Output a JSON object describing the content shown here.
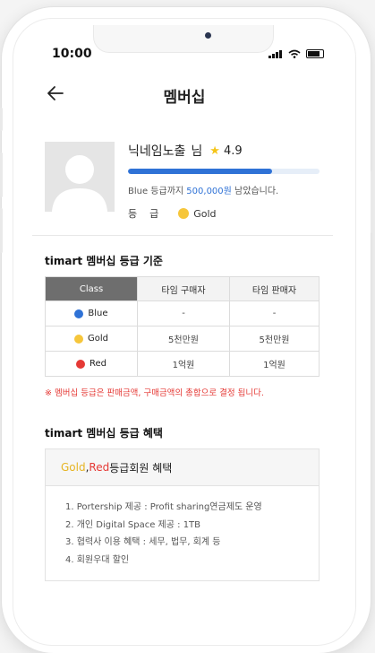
{
  "status_bar": {
    "time": "10:00"
  },
  "header": {
    "title": "멤버십"
  },
  "profile": {
    "nickname": "닉네임노출",
    "suffix": "님",
    "rating": "4.9",
    "progress": 0.75,
    "upgrade_prefix": "Blue 등급까지 ",
    "upgrade_amount": "500,000원",
    "upgrade_suffix": " 남았습니다.",
    "grade_label": "등급",
    "grade_value": "Gold"
  },
  "criteria": {
    "title": "timart 멤버십 등급 기준",
    "columns": [
      "Class",
      "타임 구매자",
      "타임 판매자"
    ],
    "rows": [
      {
        "class": "Blue",
        "color": "#2f72d6",
        "buyer": "-",
        "seller": "-"
      },
      {
        "class": "Gold",
        "color": "#f6c63b",
        "buyer": "5천만원",
        "seller": "5천만원"
      },
      {
        "class": "Red",
        "color": "#e53935",
        "buyer": "1억원",
        "seller": "1억원"
      }
    ],
    "notice": "※ 멤버십 등급은 판매금액, 구매금액의 총합으로 결정 됩니다."
  },
  "benefits": {
    "title": "timart 멤버십 등급 혜택",
    "head_gold": "Gold",
    "head_sep": ", ",
    "head_red": "Red",
    "head_rest": " 등급회원 혜택",
    "items": [
      "1. Portership 제공 : Profit sharing연금제도 운영",
      "2. 개인 Digital Space 제공 : 1TB",
      "3. 협력사 이용 혜택 : 세무, 법무, 회계 등",
      "4. 회원우대 할인"
    ]
  },
  "colors": {
    "accent": "#2f72d6",
    "gold": "#f6c63b",
    "red": "#e53935"
  }
}
